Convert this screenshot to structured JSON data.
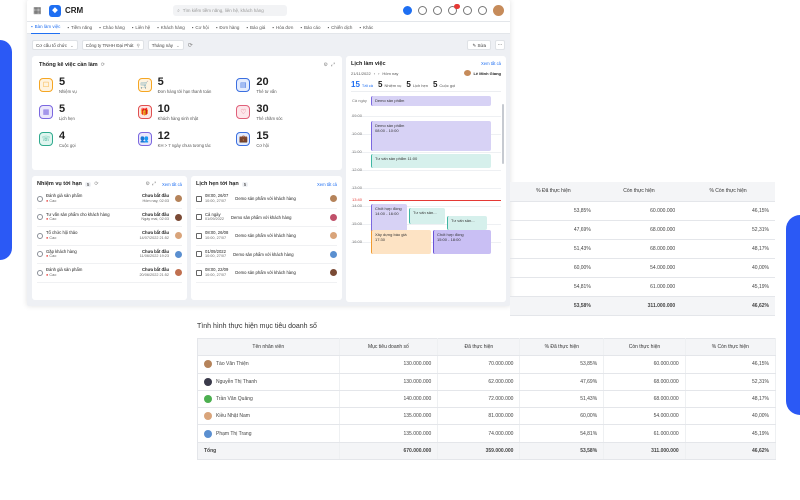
{
  "app": {
    "brand": "CRM",
    "search_placeholder": "Tìm kiếm tiềm năng, liên hệ, khách hàng",
    "notif_count": "10"
  },
  "nav": [
    {
      "label": "Bàn làm việc",
      "active": true
    },
    {
      "label": "Tiềm năng"
    },
    {
      "label": "Chào hàng"
    },
    {
      "label": "Liên hệ"
    },
    {
      "label": "Khách hàng"
    },
    {
      "label": "Cơ hội"
    },
    {
      "label": "Đơn hàng"
    },
    {
      "label": "Báo giá"
    },
    {
      "label": "Hóa đơn"
    },
    {
      "label": "Báo cáo"
    },
    {
      "label": "Chiến dịch"
    },
    {
      "label": "Khác"
    }
  ],
  "filters": {
    "org": "Cơ cấu tổ chức",
    "company": "Công ty TNHH Đại Phát",
    "period": "Tháng này",
    "edit": "Sửa",
    "more": "···"
  },
  "stats": {
    "title": "Thống kê việc cần làm",
    "items": [
      {
        "value": "5",
        "label": "Nhiệm vụ",
        "color": "#f5a623",
        "bg": "#fff3df",
        "icon": "task-icon"
      },
      {
        "value": "5",
        "label": "Đơn hàng tới hạn thanh toán",
        "color": "#f5a623",
        "bg": "#fff3df",
        "icon": "cart-icon"
      },
      {
        "value": "20",
        "label": "Thẻ tư vấn",
        "color": "#3b6fe0",
        "bg": "#e4ecfd",
        "icon": "card-icon"
      },
      {
        "value": "5",
        "label": "Lịch hẹn",
        "color": "#7b68e0",
        "bg": "#ebe7fb",
        "icon": "calendar-icon"
      },
      {
        "value": "10",
        "label": "Khách hàng sinh nhật",
        "color": "#e05050",
        "bg": "#fde6e6",
        "icon": "gift-icon"
      },
      {
        "value": "30",
        "label": "Thẻ chăm sóc",
        "color": "#e0607a",
        "bg": "#fde6ea",
        "icon": "heart-icon"
      },
      {
        "value": "4",
        "label": "Cuộc gọi",
        "color": "#2faa8e",
        "bg": "#dff5ef",
        "icon": "phone-icon"
      },
      {
        "value": "12",
        "label": "KH > 7 ngày chưa tương tác",
        "color": "#7b68e0",
        "bg": "#ebe7fb",
        "icon": "users-icon"
      },
      {
        "value": "15",
        "label": "Cơ hội",
        "color": "#3b6fe0",
        "bg": "#e4ecfd",
        "icon": "briefcase-icon"
      }
    ]
  },
  "tasks": {
    "title": "Nhiệm vụ tới hạn",
    "count": "5",
    "see_all": "Xem tất cả",
    "rows": [
      {
        "title": "Đánh giá sản phẩm",
        "sub": "Cao",
        "status": "Chưa bắt đầu",
        "time": "Hôm nay, 02:03",
        "av": "#b5835a"
      },
      {
        "title": "Tư vấn sản phẩm cho khách hàng",
        "sub": "Cao",
        "status": "Chưa bắt đầu",
        "time": "Ngày mai, 02:03",
        "av": "#7a4a35"
      },
      {
        "title": "Tổ chức hội thảo",
        "sub": "Cao",
        "status": "Chưa bắt đầu",
        "time": "14/07/2022 21:52",
        "av": "#d9a47a"
      },
      {
        "title": "Gặp khách hàng",
        "sub": "Cao",
        "status": "Chưa bắt đầu",
        "time": "11/06/2022 19:23",
        "av": "#5a8fd0"
      },
      {
        "title": "Đánh giá sản phẩm",
        "sub": "Cao",
        "status": "Chưa bắt đầu",
        "time": "20/06/2022 21:52",
        "av": "#c07050"
      }
    ]
  },
  "appointments": {
    "title": "Lịch hẹn tới hạn",
    "count": "5",
    "see_all": "Xem tất cả",
    "rows": [
      {
        "date": "08:00, 26/07",
        "date2": "10:00, 27/07",
        "desc": "Demo sản phẩm với khách hàng",
        "av": "#b5835a"
      },
      {
        "date": "Cả ngày",
        "date2": "01/09/2022",
        "desc": "Demo sản phẩm với khách hàng",
        "av": "#c0506a"
      },
      {
        "date": "08:00, 26/08",
        "date2": "10:00, 27/07",
        "desc": "Demo sản phẩm với khách hàng",
        "av": "#d9a47a"
      },
      {
        "date": "01/09/2022",
        "date2": "10:00, 27/07",
        "desc": "Demo sản phẩm với khách hàng",
        "av": "#5a8fd0"
      },
      {
        "date": "08:00, 22/09",
        "date2": "10:00, 27/07",
        "desc": "Demo sản phẩm với khách hàng",
        "av": "#7a4a35"
      }
    ]
  },
  "calendar": {
    "title": "Lịch làm việc",
    "see_all": "Xem tất cả",
    "date": "21/11/2022",
    "range_label": "Hôm nay",
    "owner": "Lê Minh Giang",
    "tabs": [
      {
        "n": "15",
        "l": "Tất cả",
        "active": true
      },
      {
        "n": "5",
        "l": "Nhiệm vụ"
      },
      {
        "n": "5",
        "l": "Lịch hẹn"
      },
      {
        "n": "5",
        "l": "Cuộc gọi"
      }
    ],
    "allday_label": "Cả ngày",
    "hours": [
      "09:00",
      "10:00",
      "11:00",
      "12:00",
      "13:00",
      "14:00",
      "15:00",
      "16:00"
    ],
    "now_label": "13:40",
    "events": {
      "allday": "Demo sản phẩm",
      "e1_title": "Demo sản phẩm",
      "e1_time": "08:00 - 10:00",
      "e2": "Tư vấn sản phẩm  11:00",
      "e3_title": "Chốt hợp đồng",
      "e3_time": "14:00 - 16:00",
      "e4": "Tư vấn sản...",
      "e5": "Tư vấn sản...",
      "e6_title": "Xây dựng báo giá",
      "e6_time": "17:30",
      "e7_title": "Chốt hợp đồng",
      "e7_time": "15:00 - 18:00"
    }
  },
  "table1": {
    "headers": [
      "% Đã thực hiện",
      "Còn thực hiện",
      "% Còn thực hiện"
    ],
    "rows": [
      [
        "53,85%",
        "60.000.000",
        "46,15%"
      ],
      [
        "47,69%",
        "68.000.000",
        "52,31%"
      ],
      [
        "51,43%",
        "68.000.000",
        "48,17%"
      ],
      [
        "60,00%",
        "54.000.000",
        "40,00%"
      ],
      [
        "54,81%",
        "61.000.000",
        "45,19%"
      ]
    ],
    "total": [
      "53,58%",
      "311.000.000",
      "46,62%"
    ]
  },
  "table2": {
    "title": "Tình hình thực hiện mục tiêu doanh số",
    "headers": [
      "Tên nhân viên",
      "Mục tiêu doanh số",
      "Đã thực hiện",
      "% Đã thực hiện",
      "Còn thực hiện",
      "% Còn thực hiện"
    ],
    "rows": [
      {
        "name": "Tào Văn Thiện",
        "av": "#b5835a",
        "cells": [
          "130.000.000",
          "70.000.000",
          "53,85%",
          "60.000.000",
          "46,15%"
        ]
      },
      {
        "name": "Nguyễn Thị Thanh",
        "av": "#3a3a4a",
        "cells": [
          "130.000.000",
          "62.000.000",
          "47,69%",
          "68.000.000",
          "52,31%"
        ]
      },
      {
        "name": "Trần Văn Quảng",
        "av": "#4caf50",
        "cells": [
          "140.000.000",
          "72.000.000",
          "51,43%",
          "68.000.000",
          "48,17%"
        ]
      },
      {
        "name": "Kiều Nhật Nam",
        "av": "#d9a47a",
        "cells": [
          "135.000.000",
          "81.000.000",
          "60,00%",
          "54.000.000",
          "40,00%"
        ]
      },
      {
        "name": "Phạm Thị Trang",
        "av": "#5a8fd0",
        "cells": [
          "135.000.000",
          "74.000.000",
          "54,81%",
          "61.000.000",
          "45,19%"
        ]
      }
    ],
    "total": {
      "label": "Tổng",
      "cells": [
        "670.000.000",
        "359.000.000",
        "53,58%",
        "311.000.000",
        "46,62%"
      ]
    }
  }
}
